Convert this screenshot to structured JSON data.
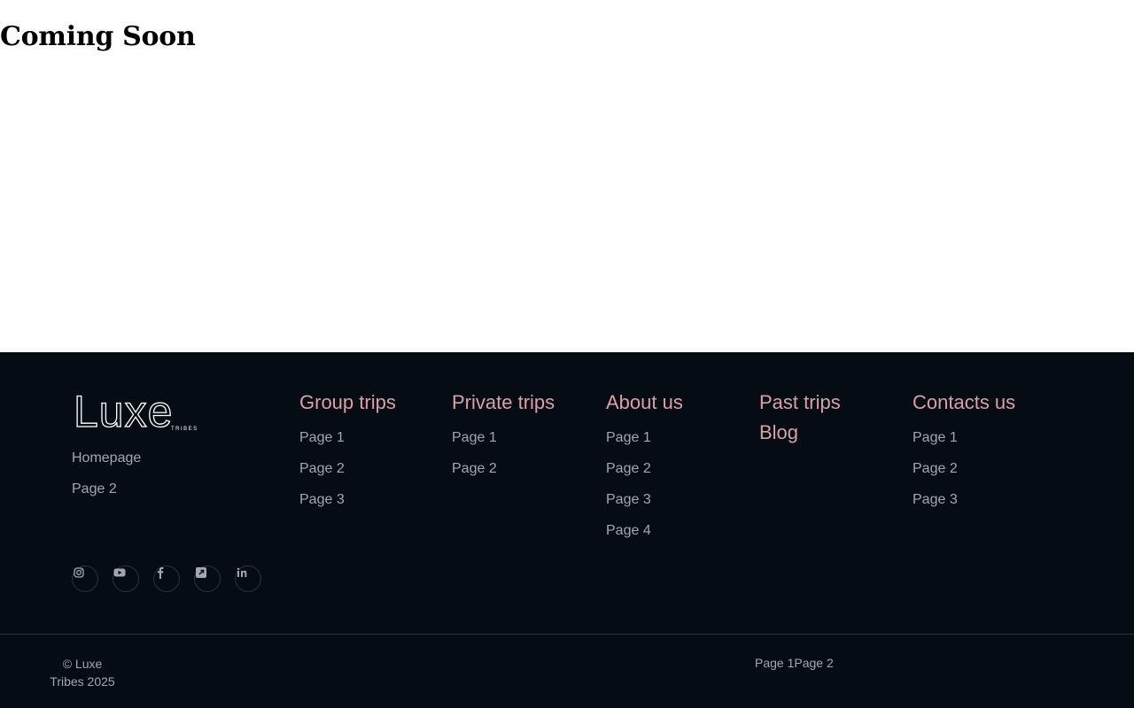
{
  "page": {
    "heading": "Coming Soon"
  },
  "footer": {
    "brand": {
      "logo_text": "Luxe",
      "logo_subtext": "TRIBES",
      "links": [
        "Homepage",
        "Page 2"
      ],
      "social_icons": [
        "instagram-icon",
        "youtube-icon",
        "facebook-icon",
        "external-link-icon",
        "linkedin-icon"
      ]
    },
    "columns": [
      {
        "title": "Group trips",
        "links": [
          "Page 1",
          "Page 2",
          "Page 3"
        ]
      },
      {
        "title": "Private trips",
        "links": [
          "Page 1",
          "Page 2"
        ]
      },
      {
        "title": "About us",
        "links": [
          "Page 1",
          "Page 2",
          "Page 3",
          "Page 4"
        ]
      },
      {
        "titles": [
          "Past trips",
          "Blog"
        ]
      },
      {
        "title": "Contacts us",
        "links": [
          "Page 1",
          "Page 2",
          "Page 3"
        ]
      }
    ],
    "copyright": "© Luxe Tribes 2025",
    "bottom_links": [
      "Page 1",
      "Page 2"
    ],
    "colors": {
      "background": "#050c14",
      "heading_accent": "#d9a0a7",
      "link_text": "#a0a7b3",
      "divider": "#2a313a"
    }
  }
}
